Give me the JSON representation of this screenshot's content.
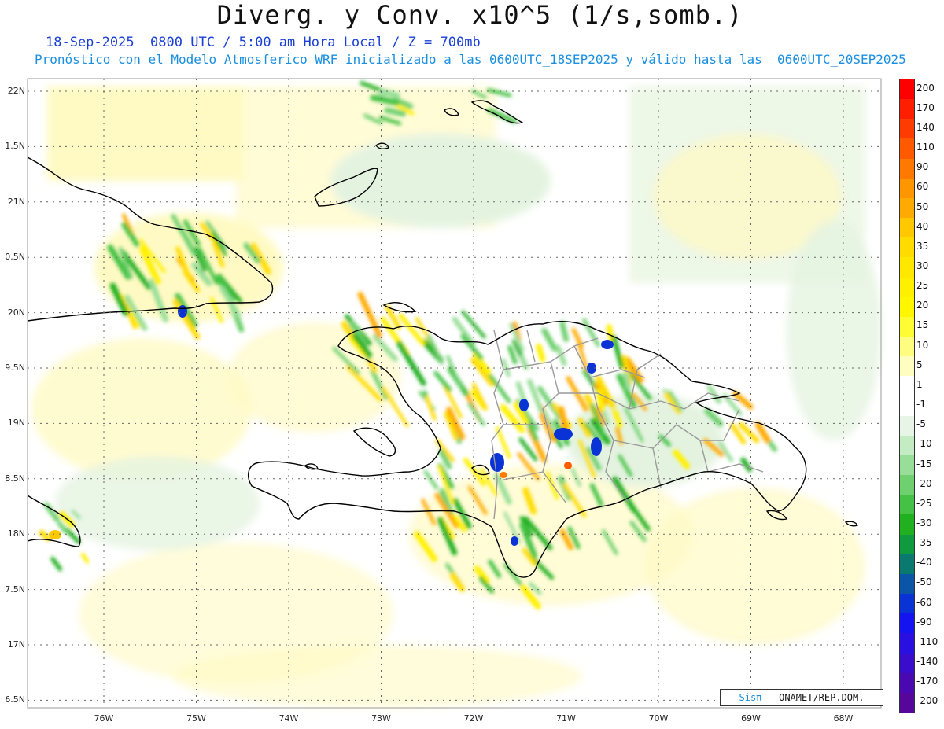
{
  "header": {
    "title": "Diverg. y Conv. x10^5 (1/s,somb.)",
    "subtitle_line1": "18-Sep-2025  0800 UTC / 5:00 am Hora Local / Z = 700mb",
    "subtitle_line2": "Pronóstico con el Modelo Atmosferico WRF inicializado a las 0600UTC_18SEP2025 y válido hasta las  0600UTC_20SEP2025"
  },
  "axes": {
    "lat_labels": [
      "22N",
      "1.5N",
      "21N",
      "0.5N",
      "20N",
      "9.5N",
      "19N",
      "8.5N",
      "18N",
      "7.5N",
      "17N",
      "6.5N"
    ],
    "lon_labels": [
      "76W",
      "75W",
      "74W",
      "73W",
      "72W",
      "71W",
      "70W",
      "69W",
      "68W"
    ],
    "grid": "dotted"
  },
  "legend": {
    "levels": [
      "200",
      "170",
      "140",
      "110",
      "90",
      "60",
      "50",
      "40",
      "35",
      "30",
      "25",
      "20",
      "15",
      "10",
      "5",
      "1",
      "-1",
      "-5",
      "-10",
      "-15",
      "-20",
      "-25",
      "-30",
      "-35",
      "-40",
      "-50",
      "-60",
      "-90",
      "-110",
      "-140",
      "-170",
      "-200"
    ],
    "colors": [
      "#ff0000",
      "#ff1e00",
      "#ff3c00",
      "#ff5a00",
      "#ff7800",
      "#ff9600",
      "#ffaa00",
      "#ffc800",
      "#ffdc00",
      "#ffe800",
      "#fff000",
      "#fff700",
      "#fffc33",
      "#fffd80",
      "#fffec0",
      "#ffffff",
      "#ffffff",
      "#e6f5e6",
      "#c3ecc3",
      "#98de98",
      "#6fd06f",
      "#45c245",
      "#20b020",
      "#0f9a40",
      "#0a7a70",
      "#0a55a8",
      "#0a33d6",
      "#1414f0",
      "#2a10e0",
      "#3a0ccc",
      "#4a08b0",
      "#56069a"
    ]
  },
  "credit": {
    "brand": "Sisπ",
    "text": "- ONAMET/REP.DOM."
  },
  "style": {
    "coast_color": "#000000",
    "province_color": "#999999",
    "field_yellow": "#fffac0",
    "field_green": "#c8ecc8"
  }
}
